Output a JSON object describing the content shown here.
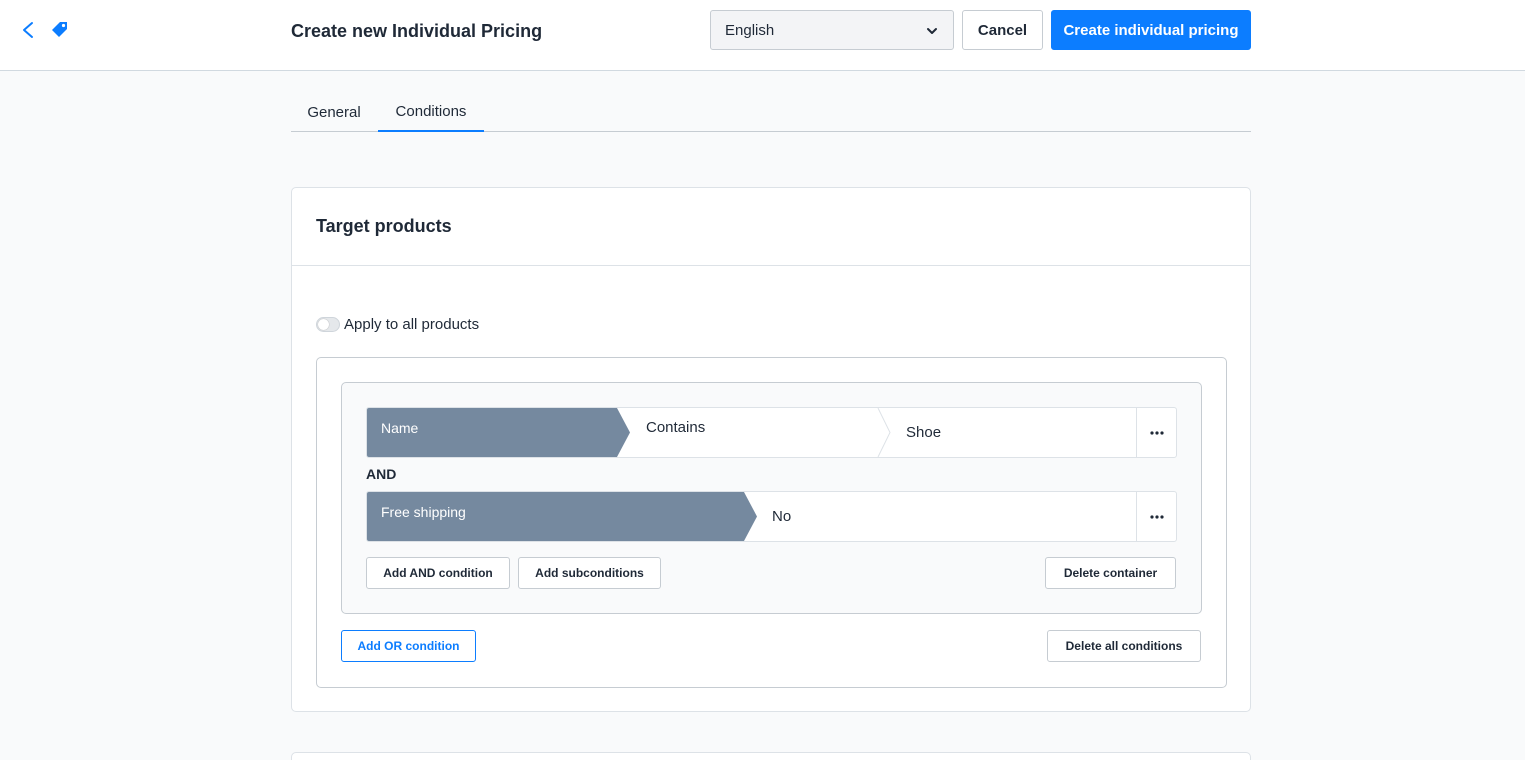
{
  "header": {
    "title": "Create new Individual Pricing",
    "language": "English",
    "cancel_label": "Cancel",
    "create_label": "Create individual pricing"
  },
  "icons": {
    "back": "chevron-left-icon",
    "entity": "price-tag-icon",
    "dropdown": "chevron-down-icon",
    "more": "ellipsis-icon"
  },
  "tabs": [
    {
      "label": "General",
      "active": false
    },
    {
      "label": "Conditions",
      "active": true
    }
  ],
  "target_products": {
    "title": "Target products",
    "apply_all_label": "Apply to all products",
    "apply_all_enabled": false,
    "conditions": [
      {
        "field": "Name",
        "operator": "Contains",
        "value": "Shoe"
      },
      {
        "field": "Free shipping",
        "operator": "",
        "value": "No"
      }
    ],
    "and_label": "AND",
    "add_and_label": "Add AND condition",
    "add_sub_label": "Add subconditions",
    "delete_container_label": "Delete container",
    "add_or_label": "Add OR condition",
    "delete_all_label": "Delete all conditions"
  },
  "colors": {
    "primary": "#0c7dff",
    "field_chip": "#75899f",
    "border": "#c6ccd2",
    "background": "#f9fafb"
  }
}
